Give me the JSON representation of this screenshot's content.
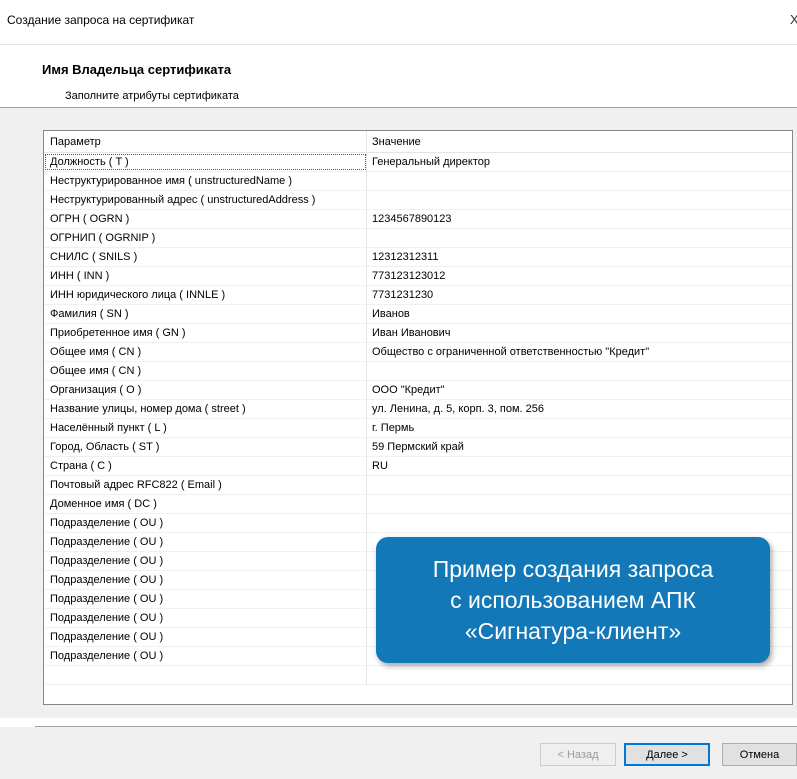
{
  "window": {
    "title": "Создание запроса на сертификат",
    "close_glyph": "X"
  },
  "header": {
    "heading": "Имя Владельца сертификата",
    "subheading": "Заполните атрибуты сертификата"
  },
  "table": {
    "columns": {
      "param": "Параметр",
      "value": "Значение"
    },
    "rows": [
      {
        "param": "Должность ( T )",
        "value": "Генеральный директор"
      },
      {
        "param": "Неструктурированное имя ( unstructuredName )",
        "value": ""
      },
      {
        "param": "Неструктурированный адрес ( unstructuredAddress )",
        "value": ""
      },
      {
        "param": "ОГРН ( OGRN )",
        "value": "1234567890123"
      },
      {
        "param": "ОГРНИП ( OGRNIP )",
        "value": ""
      },
      {
        "param": "СНИЛС ( SNILS )",
        "value": "12312312311"
      },
      {
        "param": "ИНН ( INN )",
        "value": "773123123012"
      },
      {
        "param": "ИНН юридического лица ( INNLE )",
        "value": "7731231230"
      },
      {
        "param": "Фамилия ( SN )",
        "value": "Иванов"
      },
      {
        "param": "Приобретенное имя ( GN )",
        "value": "Иван Иванович"
      },
      {
        "param": "Общее имя ( CN )",
        "value": "Общество с ограниченной ответственностью \"Кредит\""
      },
      {
        "param": "Общее имя ( CN )",
        "value": ""
      },
      {
        "param": "Организация ( O )",
        "value": "ООО \"Кредит\""
      },
      {
        "param": "Название улицы, номер дома ( street )",
        "value": "ул. Ленина, д. 5, корп. 3, пом. 256"
      },
      {
        "param": "Населённый пункт ( L )",
        "value": "г. Пермь"
      },
      {
        "param": "Город, Область ( ST )",
        "value": "59 Пермский край"
      },
      {
        "param": "Страна ( C )",
        "value": "RU"
      },
      {
        "param": "Почтовый адрес RFC822 ( Email )",
        "value": ""
      },
      {
        "param": "Доменное имя ( DC )",
        "value": ""
      },
      {
        "param": "Подразделение ( OU )",
        "value": ""
      },
      {
        "param": "Подразделение ( OU )",
        "value": ""
      },
      {
        "param": "Подразделение ( OU )",
        "value": ""
      },
      {
        "param": "Подразделение ( OU )",
        "value": ""
      },
      {
        "param": "Подразделение ( OU )",
        "value": ""
      },
      {
        "param": "Подразделение ( OU )",
        "value": ""
      },
      {
        "param": "Подразделение ( OU )",
        "value": ""
      },
      {
        "param": "Подразделение ( OU )",
        "value": ""
      },
      {
        "param": "",
        "value": ""
      }
    ]
  },
  "overlay": {
    "line1": "Пример создания запроса",
    "line2": "с использованием АПК",
    "line3": "«Сигнатура-клиент»",
    "color": "#1378b8"
  },
  "buttons": {
    "back": "< Назад",
    "next": "Далее >",
    "cancel": "Отмена"
  }
}
